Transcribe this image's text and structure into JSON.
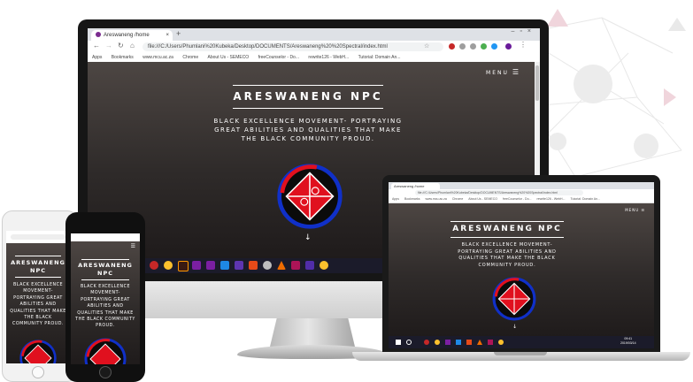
{
  "site": {
    "menu_label": "MENU",
    "title": "ARESWANENG NPC",
    "tagline": "BLACK EXCELLENCE MOVEMENT- PORTRAYING GREAT ABILITIES AND QUALITIES THAT MAKE THE BLACK COMMUNITY PROUD."
  },
  "browser": {
    "tab_title": "Areswaneng /home",
    "url": "file:///C:/Users/Phumlani%20Kubeka/Desktop/DOCUMENTS/Areswaneng%20%20Spectral/index.html",
    "bookmarks": [
      "Apps",
      "Bookmarks",
      "www.mcu.ac.za",
      "Chrome",
      "About Us - SEMECO",
      "freeCounselor - Do...",
      "rewrite126 - WebH...",
      "Tutorial: Domain An..."
    ]
  },
  "laptop": {
    "taskbar_time": "09:41",
    "taskbar_date": "2019/03/14"
  },
  "icons": {
    "scroll_down": "scroll-down-arrow-icon",
    "menu": "hamburger-menu-icon"
  },
  "colors": {
    "logo_red": "#e0101e",
    "logo_blue": "#1030c8",
    "site_bg": "#3a3433"
  }
}
